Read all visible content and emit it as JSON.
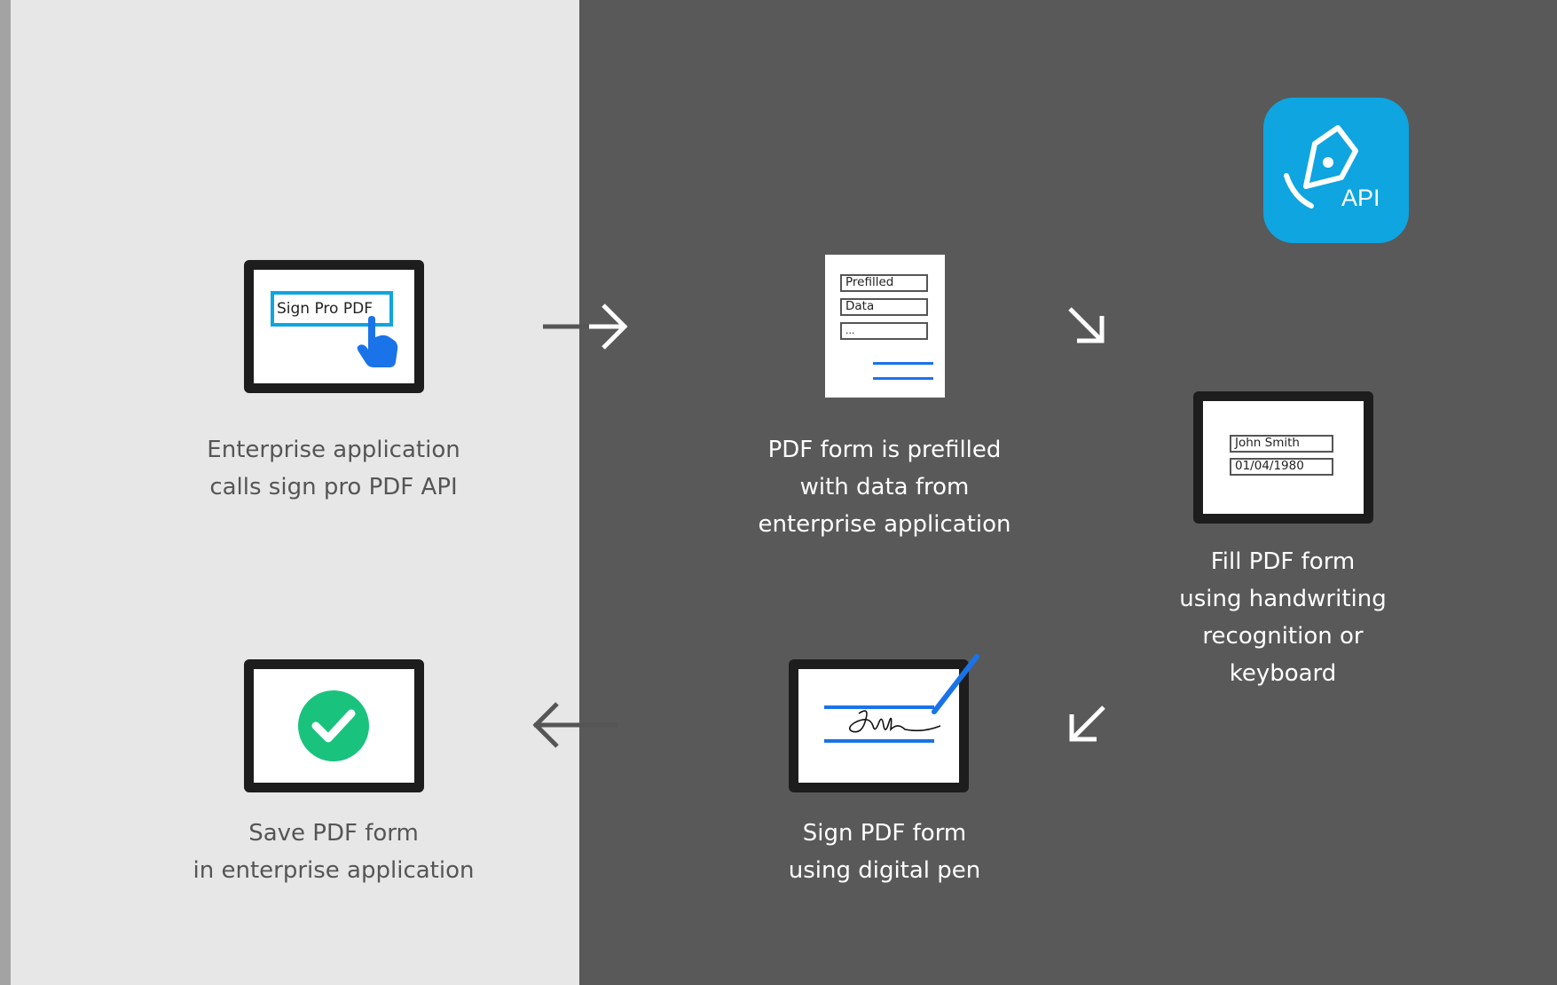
{
  "colors": {
    "left_panel": "#e7e7e7",
    "right_panel": "#595959",
    "accent_blue": "#0ea5e0",
    "pen_blue": "#1a73e8",
    "success_green": "#19c37d"
  },
  "api_badge": {
    "icon": "pen-nib-icon",
    "label": "API"
  },
  "steps": [
    {
      "icon": "tablet-tap-icon",
      "screen": {
        "button_label": "Sign Pro PDF"
      },
      "caption": [
        "Enterprise application",
        "calls sign pro PDF API"
      ]
    },
    {
      "icon": "document-icon",
      "screen": {
        "fields": [
          "Prefilled",
          "Data",
          "..."
        ]
      },
      "caption": [
        "PDF form is prefilled",
        "with data from",
        "enterprise application"
      ]
    },
    {
      "icon": "tablet-form-icon",
      "screen": {
        "fields": [
          "John Smith",
          "01/04/1980"
        ]
      },
      "caption": [
        "Fill PDF form",
        "using handwriting",
        "recognition or",
        "keyboard"
      ]
    },
    {
      "icon": "tablet-signature-icon",
      "caption": [
        "Sign PDF form",
        "using digital pen"
      ]
    },
    {
      "icon": "tablet-checkmark-icon",
      "caption": [
        "Save PDF form",
        "in enterprise application"
      ]
    }
  ],
  "arrows": [
    {
      "name": "arrow-right-icon",
      "from": 1,
      "to": 2
    },
    {
      "name": "arrow-down-right-icon",
      "from": 2,
      "to": 3
    },
    {
      "name": "arrow-down-left-icon",
      "from": 3,
      "to": 4
    },
    {
      "name": "arrow-left-icon",
      "from": 4,
      "to": 5
    }
  ]
}
